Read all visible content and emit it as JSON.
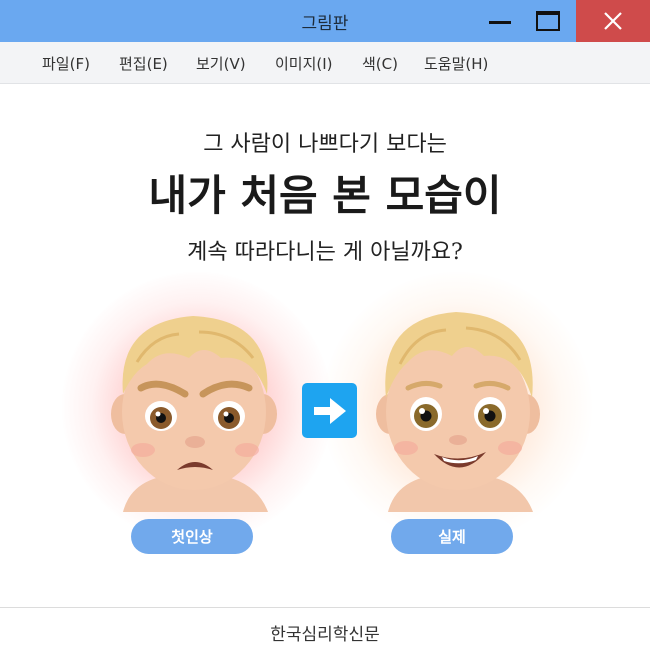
{
  "window": {
    "title": "그림판"
  },
  "menu": [
    "파일(F)",
    "편집(E)",
    "보기(V)",
    "이미지(I)",
    "색(C)",
    "도움말(H)"
  ],
  "content": {
    "line1": "그 사람이 나쁘다기 보다는",
    "line2": "내가 처음 본 모습이",
    "line3": "계속 따라다니는 게 아닐까요?",
    "label_left": "첫인상",
    "label_right": "실제",
    "footer": "한국심리학신문"
  },
  "icons": {
    "arrow": "right-arrow-icon",
    "face_left": "angry-baby-emoji",
    "face_right": "smiling-baby-emoji"
  },
  "colors": {
    "titlebar": "#6aa8f0",
    "close": "#cf4b4b",
    "highlight": "#f7f24a",
    "arrow": "#1ea4f0",
    "pill": "#71a9ec"
  }
}
